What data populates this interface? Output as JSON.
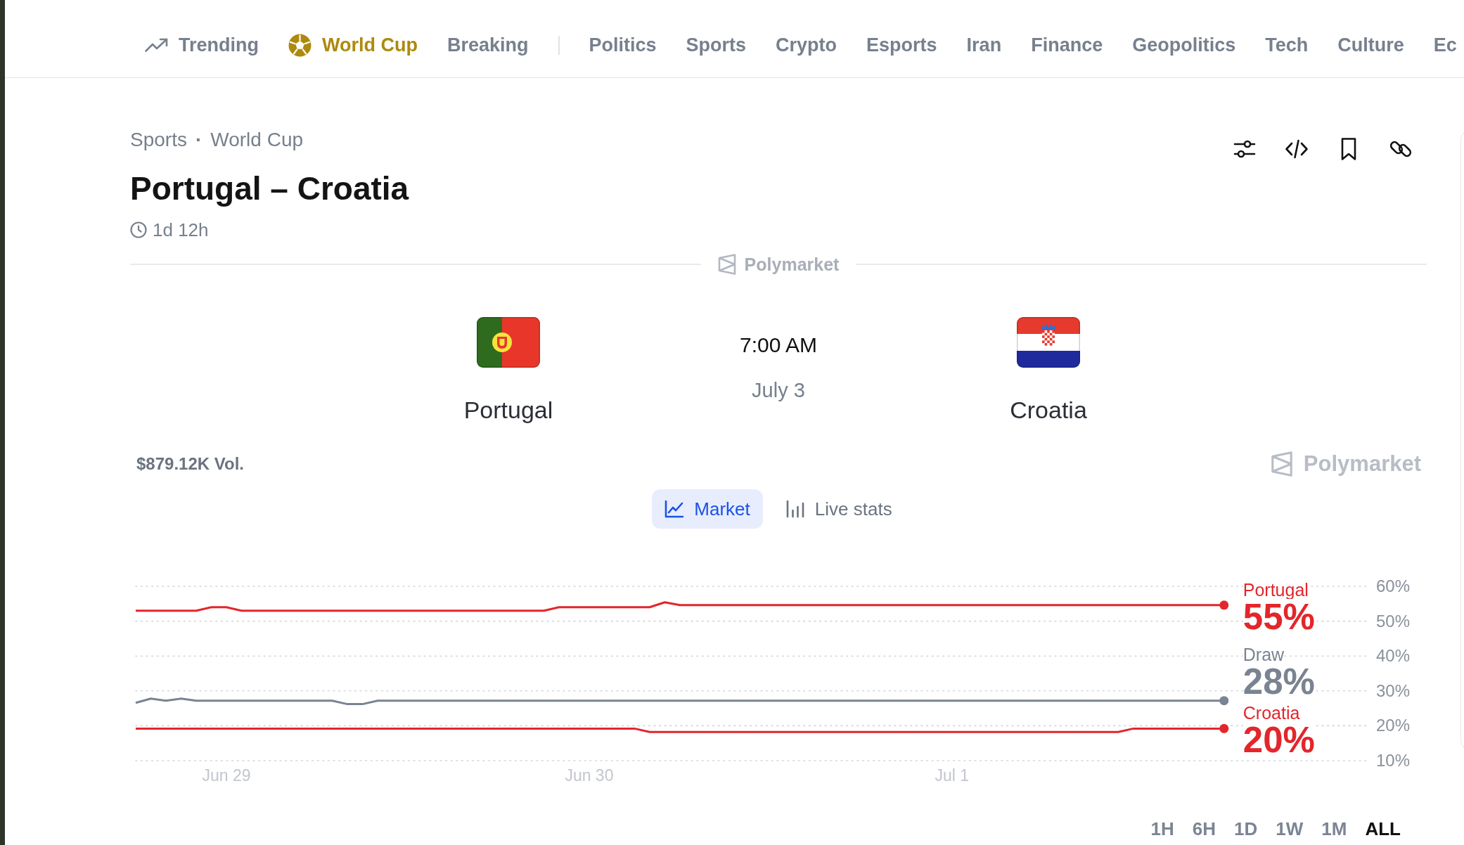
{
  "nav": {
    "highlights": [
      {
        "kind": "trending",
        "label": "Trending"
      },
      {
        "kind": "featured",
        "label": "World Cup"
      },
      {
        "kind": "plain",
        "label": "Breaking"
      }
    ],
    "categories": [
      "Politics",
      "Sports",
      "Crypto",
      "Esports",
      "Iran",
      "Finance",
      "Geopolitics",
      "Tech",
      "Culture",
      "Ec"
    ]
  },
  "event": {
    "breadcrumb": {
      "items": [
        "Sports",
        "World Cup"
      ],
      "separator": "·"
    },
    "title": "Portugal – Croatia",
    "countdown": "1d 12h"
  },
  "source_divider": {
    "label": "Polymarket"
  },
  "match": {
    "teams": [
      {
        "name": "Portugal",
        "kind": "portugal"
      },
      {
        "name": "Croatia",
        "kind": "croatia"
      }
    ],
    "time": "7:00 AM",
    "date": "July 3"
  },
  "market": {
    "volume": "$879.12K Vol.",
    "brand": "Polymarket",
    "tabs": [
      {
        "kind": "line",
        "label": "Market",
        "selected": true
      },
      {
        "kind": "bars",
        "label": "Live stats",
        "selected": false
      }
    ],
    "chart_data": {
      "type": "line",
      "grid": true,
      "categories": [
        null,
        null,
        null,
        null,
        null,
        null,
        "Jun 29",
        null,
        null,
        null,
        null,
        null,
        null,
        null,
        null,
        null,
        null,
        null,
        null,
        null,
        null,
        null,
        null,
        null,
        null,
        null,
        null,
        null,
        null,
        null,
        "Jun 30",
        null,
        null,
        null,
        null,
        null,
        null,
        null,
        null,
        null,
        null,
        null,
        null,
        null,
        null,
        null,
        null,
        null,
        null,
        null,
        null,
        null,
        null,
        null,
        "Jul 1",
        null,
        null,
        null,
        null,
        null,
        null,
        null,
        null,
        null,
        null,
        null,
        null,
        null,
        null,
        null,
        null,
        null,
        null
      ],
      "series": [
        {
          "name": "Portugal",
          "color": "#e3262b",
          "values": [
            53,
            53,
            53,
            53,
            53,
            54,
            54,
            53,
            53,
            53,
            53,
            53,
            53,
            53,
            53,
            53,
            53,
            53,
            53,
            53,
            53,
            53,
            53,
            53,
            53,
            53,
            53,
            53,
            54,
            54,
            54,
            54,
            54,
            54,
            54,
            55.4,
            54.6,
            54.6,
            54.6,
            54.6,
            54.6,
            54.6,
            54.6,
            54.6,
            54.6,
            54.6,
            54.6,
            54.6,
            54.6,
            54.6,
            54.6,
            54.6,
            54.6,
            54.6,
            54.6,
            54.6,
            54.6,
            54.6,
            54.6,
            54.6,
            54.6,
            54.6,
            54.6,
            54.6,
            54.6,
            54.6,
            54.6,
            54.6,
            54.6,
            54.6,
            54.6,
            54.6,
            54.6
          ]
        },
        {
          "name": "Draw",
          "color": "#7a8391",
          "values": [
            26.6,
            27.8,
            27.2,
            27.8,
            27.2,
            27.2,
            27.2,
            27.2,
            27.2,
            27.2,
            27.2,
            27.2,
            27.2,
            27.2,
            26.2,
            26.2,
            27.2,
            27.2,
            27.2,
            27.2,
            27.2,
            27.2,
            27.2,
            27.2,
            27.2,
            27.2,
            27.2,
            27.2,
            27.2,
            27.2,
            27.2,
            27.2,
            27.2,
            27.2,
            27.2,
            27.2,
            27.2,
            27.2,
            27.2,
            27.2,
            27.2,
            27.2,
            27.2,
            27.2,
            27.2,
            27.2,
            27.2,
            27.2,
            27.2,
            27.2,
            27.2,
            27.2,
            27.2,
            27.2,
            27.2,
            27.2,
            27.2,
            27.2,
            27.2,
            27.2,
            27.2,
            27.2,
            27.2,
            27.2,
            27.2,
            27.2,
            27.2,
            27.2,
            27.2,
            27.2,
            27.2,
            27.2,
            27.2
          ]
        },
        {
          "name": "Croatia",
          "color": "#e3262b",
          "values": [
            19.2,
            19.2,
            19.2,
            19.2,
            19.2,
            19.2,
            19.2,
            19.2,
            19.2,
            19.2,
            19.2,
            19.2,
            19.2,
            19.2,
            19.2,
            19.2,
            19.2,
            19.2,
            19.2,
            19.2,
            19.2,
            19.2,
            19.2,
            19.2,
            19.2,
            19.2,
            19.2,
            19.2,
            19.2,
            19.2,
            19.2,
            19.2,
            19.2,
            19.2,
            18.2,
            18.2,
            18.2,
            18.2,
            18.2,
            18.2,
            18.2,
            18.2,
            18.2,
            18.2,
            18.2,
            18.2,
            18.2,
            18.2,
            18.2,
            18.2,
            18.2,
            18.2,
            18.2,
            18.2,
            18.2,
            18.2,
            18.2,
            18.2,
            18.2,
            18.2,
            18.2,
            18.2,
            18.2,
            18.2,
            18.2,
            18.2,
            19.2,
            19.2,
            19.2,
            19.2,
            19.2,
            19.2,
            19.2
          ]
        }
      ],
      "ylim": [
        10,
        60
      ],
      "yticks": [
        {
          "value": 10,
          "label": "10%"
        },
        {
          "value": 20,
          "label": "20%"
        },
        {
          "value": 30,
          "label": "30%"
        },
        {
          "value": 40,
          "label": "40%"
        },
        {
          "value": 50,
          "label": "50%"
        },
        {
          "value": 60,
          "label": "60%"
        }
      ],
      "value_labels": [
        "55%",
        "28%",
        "20%"
      ]
    },
    "ranges": [
      {
        "label": "1H",
        "selected": false
      },
      {
        "label": "6H",
        "selected": false
      },
      {
        "label": "1D",
        "selected": false
      },
      {
        "label": "1W",
        "selected": false
      },
      {
        "label": "1M",
        "selected": false
      },
      {
        "label": "ALL",
        "selected": true
      }
    ]
  }
}
